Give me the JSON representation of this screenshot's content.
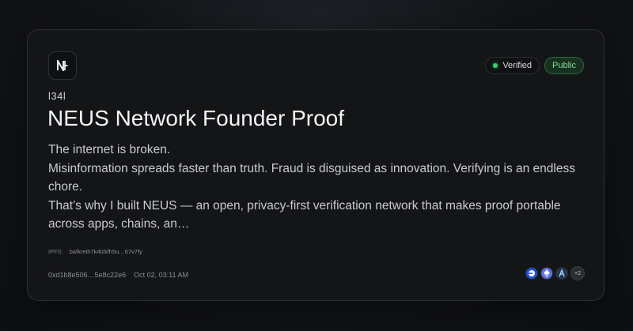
{
  "card": {
    "logo": "neus-logo-icon",
    "badges": {
      "verified": "Verified",
      "public": "Public"
    },
    "author": "l34l",
    "title": "NEUS Network Founder Proof",
    "body": [
      "The internet is broken.",
      "Misinformation spreads faster than truth. Fraud is disguised as innovation. Verifying is an endless chore.",
      "That’s why I built NEUS — an open, privacy-first verification network that makes proof portable across apps, chains, an…"
    ],
    "ipfs": {
      "label": "IPFS:",
      "hash": "bafkreih7k4lzkfh5u…67v7fy"
    },
    "meta": {
      "address": "0xd1b8e506…5e8c22e6",
      "timestamp": "Oct 02, 03:11 AM"
    },
    "chains": {
      "icons": [
        "base-chain-icon",
        "ethereum-chain-icon",
        "arbitrum-chain-icon"
      ],
      "more": "+2"
    }
  },
  "colors": {
    "background": "#121418",
    "card": "#141517",
    "verified_dot": "#3ecf6f",
    "public_badge_bg": "#17301f",
    "public_badge_text": "#7fdc9b"
  }
}
